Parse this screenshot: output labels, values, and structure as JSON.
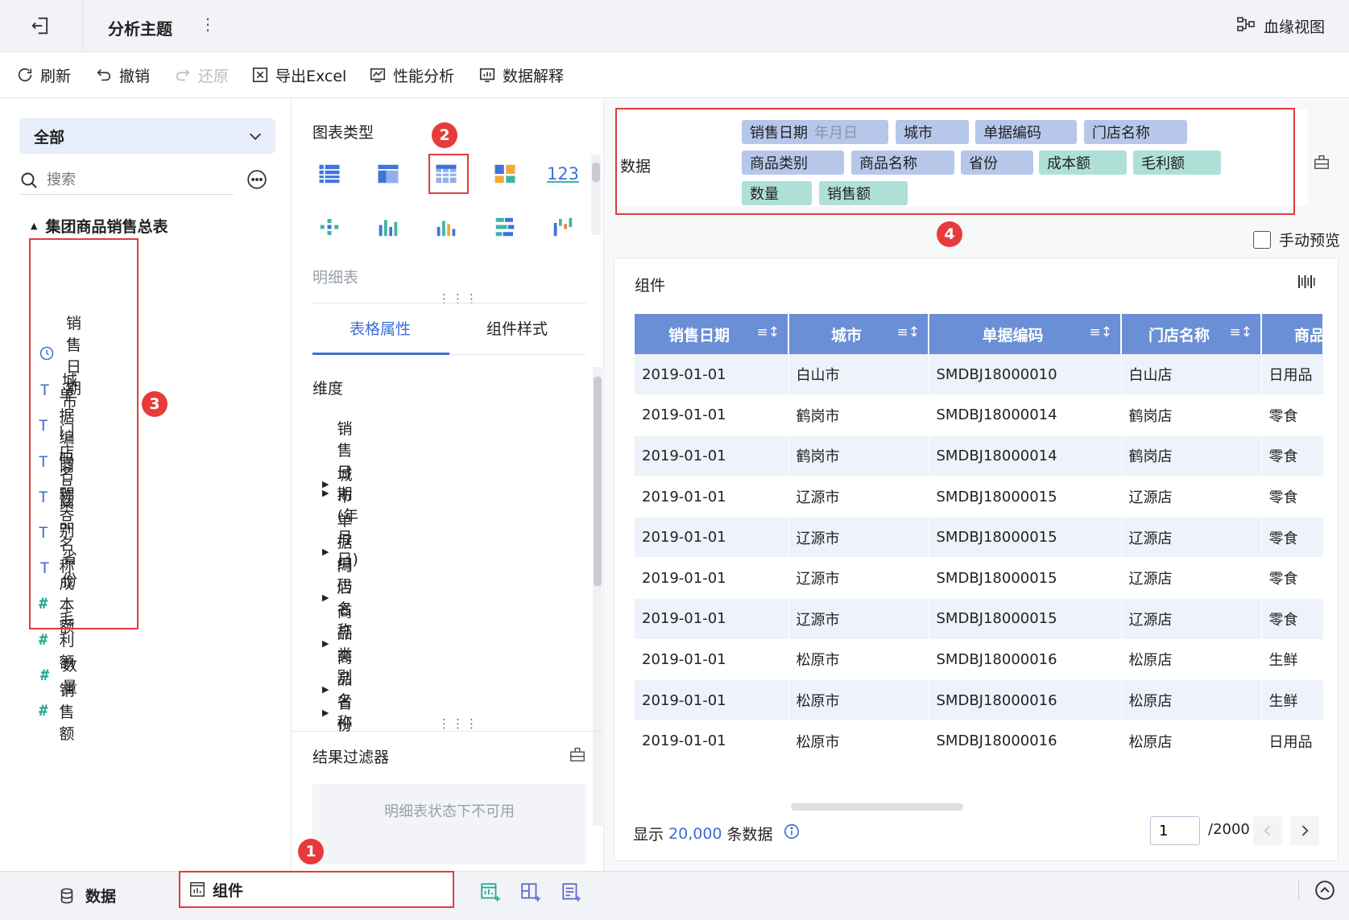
{
  "topbar": {
    "title": "分析主题",
    "more": "⋮",
    "lineage_label": "血缘视图"
  },
  "toolbar": {
    "refresh": "刷新",
    "undo": "撤销",
    "redo": "还原",
    "export": "导出Excel",
    "perf": "性能分析",
    "explain": "数据解释"
  },
  "left": {
    "scope": "全部",
    "search_placeholder": "搜索",
    "table_name": "集团商品销售总表",
    "fields": [
      {
        "name": "销售日期",
        "type": "date"
      },
      {
        "name": "城市",
        "type": "text"
      },
      {
        "name": "单据编码",
        "type": "text"
      },
      {
        "name": "门店名称",
        "type": "text"
      },
      {
        "name": "商品类别",
        "type": "text"
      },
      {
        "name": "商品名称",
        "type": "text"
      },
      {
        "name": "省份",
        "type": "text"
      },
      {
        "name": "成本额",
        "type": "number"
      },
      {
        "name": "毛利额",
        "type": "number"
      },
      {
        "name": "数量",
        "type": "number"
      },
      {
        "name": "销售额",
        "type": "number"
      }
    ]
  },
  "mid": {
    "chart_type_title": "图表类型",
    "chart_type_name": "明细表",
    "kpi_glyph": "123",
    "tabs": [
      "表格属性",
      "组件样式"
    ],
    "dim_title": "维度",
    "dims": [
      "销售日期(年月日)",
      "城市",
      "单据编码",
      "门店名称",
      "商品类别",
      "商品名称",
      "省份"
    ],
    "filter_title": "结果过滤器",
    "filter_disabled": "明细表状态下不可用"
  },
  "right": {
    "data_label": "数据",
    "chips": [
      {
        "label": "销售日期",
        "sub": "年月日",
        "kind": "dim"
      },
      {
        "label": "城市",
        "kind": "dim"
      },
      {
        "label": "单据编码",
        "kind": "dim"
      },
      {
        "label": "门店名称",
        "kind": "dim"
      },
      {
        "label": "商品类别",
        "kind": "dim"
      },
      {
        "label": "商品名称",
        "kind": "dim"
      },
      {
        "label": "省份",
        "kind": "dim"
      },
      {
        "label": "成本额",
        "kind": "measure"
      },
      {
        "label": "毛利额",
        "kind": "measure"
      },
      {
        "label": "数量",
        "kind": "measure"
      },
      {
        "label": "销售额",
        "kind": "measure"
      }
    ],
    "manual_preview": "手动预览",
    "component_title": "组件",
    "columns": [
      "销售日期",
      "城市",
      "单据编码",
      "门店名称",
      "商品"
    ],
    "rows": [
      [
        "2019-01-01",
        "白山市",
        "SMDBJ18000010",
        "白山店",
        "日用品"
      ],
      [
        "2019-01-01",
        "鹤岗市",
        "SMDBJ18000014",
        "鹤岗店",
        "零食"
      ],
      [
        "2019-01-01",
        "鹤岗市",
        "SMDBJ18000014",
        "鹤岗店",
        "零食"
      ],
      [
        "2019-01-01",
        "辽源市",
        "SMDBJ18000015",
        "辽源店",
        "零食"
      ],
      [
        "2019-01-01",
        "辽源市",
        "SMDBJ18000015",
        "辽源店",
        "零食"
      ],
      [
        "2019-01-01",
        "辽源市",
        "SMDBJ18000015",
        "辽源店",
        "零食"
      ],
      [
        "2019-01-01",
        "辽源市",
        "SMDBJ18000015",
        "辽源店",
        "零食"
      ],
      [
        "2019-01-01",
        "松原市",
        "SMDBJ18000016",
        "松原店",
        "生鲜"
      ],
      [
        "2019-01-01",
        "松原市",
        "SMDBJ18000016",
        "松原店",
        "生鲜"
      ],
      [
        "2019-01-01",
        "松原市",
        "SMDBJ18000016",
        "松原店",
        "日用品"
      ]
    ],
    "footer_prefix": "显示",
    "footer_count": "20,000",
    "footer_suffix": "条数据",
    "page_value": "1",
    "page_total": "/2000"
  },
  "bottom": {
    "data_tab": "数据",
    "component_tab": "组件"
  },
  "badges": [
    "1",
    "2",
    "3",
    "4"
  ],
  "colors": {
    "accent": "#3b6fd4",
    "header_blue": "#6a8fd6",
    "dim_chip": "#b6c7ea",
    "measure_chip": "#afe0d7",
    "highlight_red": "#e33b3b"
  }
}
